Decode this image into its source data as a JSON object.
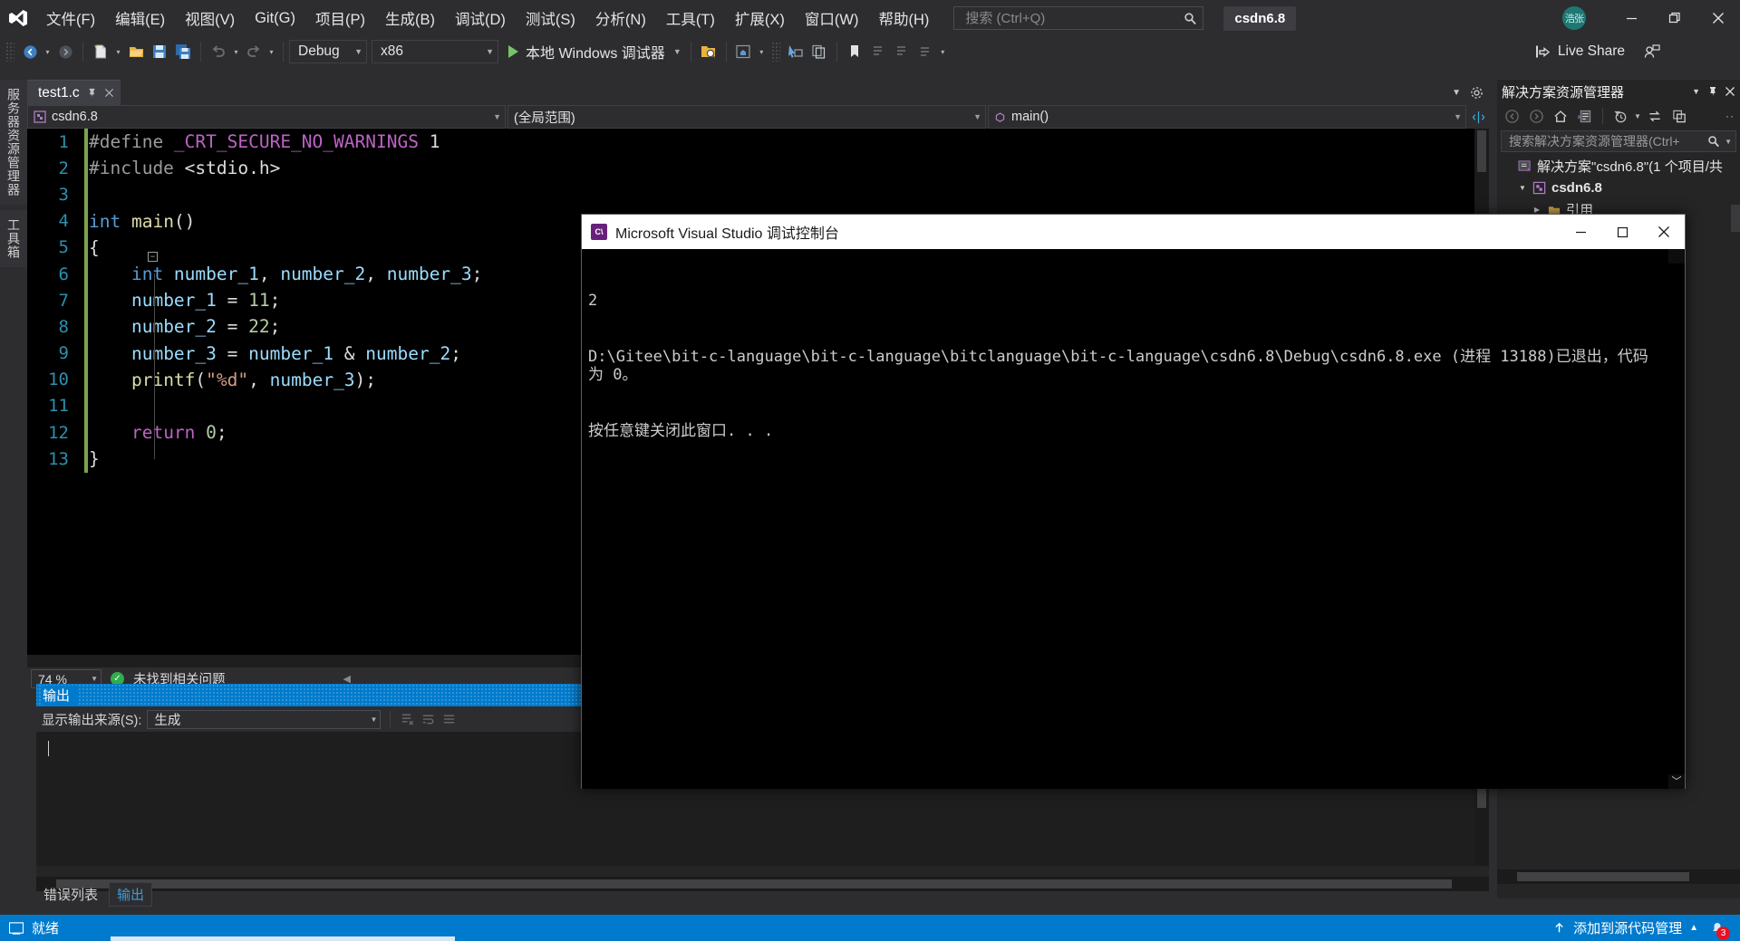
{
  "window": {
    "app_title": "Microsoft Visual Studio",
    "solution_badge": "csdn6.8",
    "avatar_initials": "浩张"
  },
  "menu": {
    "items": [
      {
        "label": "文件(F)",
        "name": "menu-file"
      },
      {
        "label": "编辑(E)",
        "name": "menu-edit"
      },
      {
        "label": "视图(V)",
        "name": "menu-view"
      },
      {
        "label": "Git(G)",
        "name": "menu-git"
      },
      {
        "label": "项目(P)",
        "name": "menu-project"
      },
      {
        "label": "生成(B)",
        "name": "menu-build"
      },
      {
        "label": "调试(D)",
        "name": "menu-debug"
      },
      {
        "label": "测试(S)",
        "name": "menu-test"
      },
      {
        "label": "分析(N)",
        "name": "menu-analyze"
      },
      {
        "label": "工具(T)",
        "name": "menu-tools"
      },
      {
        "label": "扩展(X)",
        "name": "menu-extensions"
      },
      {
        "label": "窗口(W)",
        "name": "menu-window"
      },
      {
        "label": "帮助(H)",
        "name": "menu-help"
      }
    ]
  },
  "search": {
    "placeholder": "搜索 (Ctrl+Q)",
    "value": ""
  },
  "toolbar": {
    "config_value": "Debug",
    "platform_value": "x86",
    "run_label": "本地 Windows 调试器",
    "live_share_label": "Live Share"
  },
  "vertical_tabs": [
    {
      "label": "服务器资源管理器",
      "name": "vtab-server-explorer"
    },
    {
      "label": "工具箱",
      "name": "vtab-toolbox"
    }
  ],
  "editor": {
    "tab_label": "test1.c",
    "project_combo": "csdn6.8",
    "scope_combo": "(全局范围)",
    "member_combo": "main()",
    "zoom_level": "74 %",
    "issues_status": "未找到相关问题",
    "code_lines": [
      {
        "n": "1",
        "tokens": [
          {
            "t": "#define ",
            "c": "k-pp"
          },
          {
            "t": "_CRT_SECURE_NO_WARNINGS",
            "c": "k-mac"
          },
          {
            "t": " 1",
            "c": "k-plain"
          }
        ]
      },
      {
        "n": "2",
        "tokens": [
          {
            "t": "#include ",
            "c": "k-pp"
          },
          {
            "t": "<stdio.h>",
            "c": "k-plain"
          }
        ]
      },
      {
        "n": "3",
        "tokens": []
      },
      {
        "n": "4",
        "tokens": [
          {
            "t": "int ",
            "c": "k-type"
          },
          {
            "t": "main",
            "c": "k-fn"
          },
          {
            "t": "()",
            "c": "k-punc"
          }
        ]
      },
      {
        "n": "5",
        "tokens": [
          {
            "t": "{",
            "c": "k-punc"
          }
        ]
      },
      {
        "n": "6",
        "tokens": [
          {
            "t": "    int ",
            "c": "k-type"
          },
          {
            "t": "number_1",
            "c": "k-id"
          },
          {
            "t": ", ",
            "c": "k-punc"
          },
          {
            "t": "number_2",
            "c": "k-id"
          },
          {
            "t": ", ",
            "c": "k-punc"
          },
          {
            "t": "number_3",
            "c": "k-id"
          },
          {
            "t": ";",
            "c": "k-punc"
          }
        ]
      },
      {
        "n": "7",
        "tokens": [
          {
            "t": "    ",
            "c": "k-plain"
          },
          {
            "t": "number_1",
            "c": "k-id"
          },
          {
            "t": " = ",
            "c": "k-punc"
          },
          {
            "t": "11",
            "c": "k-num"
          },
          {
            "t": ";",
            "c": "k-punc"
          }
        ]
      },
      {
        "n": "8",
        "tokens": [
          {
            "t": "    ",
            "c": "k-plain"
          },
          {
            "t": "number_2",
            "c": "k-id"
          },
          {
            "t": " = ",
            "c": "k-punc"
          },
          {
            "t": "22",
            "c": "k-num"
          },
          {
            "t": ";",
            "c": "k-punc"
          }
        ]
      },
      {
        "n": "9",
        "tokens": [
          {
            "t": "    ",
            "c": "k-plain"
          },
          {
            "t": "number_3",
            "c": "k-id"
          },
          {
            "t": " = ",
            "c": "k-punc"
          },
          {
            "t": "number_1",
            "c": "k-id"
          },
          {
            "t": " & ",
            "c": "k-punc"
          },
          {
            "t": "number_2",
            "c": "k-id"
          },
          {
            "t": ";",
            "c": "k-punc"
          }
        ]
      },
      {
        "n": "10",
        "tokens": [
          {
            "t": "    ",
            "c": "k-plain"
          },
          {
            "t": "printf",
            "c": "k-fn"
          },
          {
            "t": "(",
            "c": "k-punc"
          },
          {
            "t": "\"%d\"",
            "c": "k-str"
          },
          {
            "t": ", ",
            "c": "k-punc"
          },
          {
            "t": "number_3",
            "c": "k-id"
          },
          {
            "t": ");",
            "c": "k-punc"
          }
        ]
      },
      {
        "n": "11",
        "tokens": []
      },
      {
        "n": "12",
        "tokens": [
          {
            "t": "    ",
            "c": "k-plain"
          },
          {
            "t": "return ",
            "c": "k-mac"
          },
          {
            "t": "0",
            "c": "k-num"
          },
          {
            "t": ";",
            "c": "k-punc"
          }
        ]
      },
      {
        "n": "13",
        "tokens": [
          {
            "t": "}",
            "c": "k-punc"
          }
        ]
      }
    ]
  },
  "output_panel": {
    "title": "输出",
    "source_label": "显示输出来源(S):",
    "source_value": "生成",
    "body_text": ""
  },
  "bottom_tabs": [
    {
      "label": "错误列表",
      "name": "bottom-tab-error-list",
      "active": false
    },
    {
      "label": "输出",
      "name": "bottom-tab-output",
      "active": true
    }
  ],
  "solution_explorer": {
    "title": "解决方案资源管理器",
    "search_placeholder": "搜索解决方案资源管理器(Ctrl+;",
    "search_value": "",
    "tree": [
      {
        "label": "解决方案\"csdn6.8\"(1 个项目/共",
        "name": "solution-node",
        "indent": 0,
        "bold": false
      },
      {
        "label": "csdn6.8",
        "name": "project-node-csdn68",
        "indent": 1,
        "bold": true
      },
      {
        "label": "引用",
        "name": "references-node",
        "indent": 2,
        "bold": false
      }
    ]
  },
  "console_window": {
    "title": "Microsoft Visual Studio 调试控制台",
    "icon_label": "C\\",
    "lines": [
      "2",
      "D:\\Gitee\\bit-c-language\\bit-c-language\\bitclanguage\\bit-c-language\\csdn6.8\\Debug\\csdn6.8.exe (进程 13188)已退出，代码为 0。",
      "按任意键关闭此窗口. . ."
    ]
  },
  "status_bar": {
    "ready_label": "就绪",
    "source_control_label": "添加到源代码管理",
    "notification_count": "3"
  },
  "colors": {
    "accent_blue": "#007acc",
    "chrome_bg": "#2d2d30",
    "editor_bg": "#000000",
    "panel_bg": "#252526",
    "notification_red": "#e81123"
  }
}
